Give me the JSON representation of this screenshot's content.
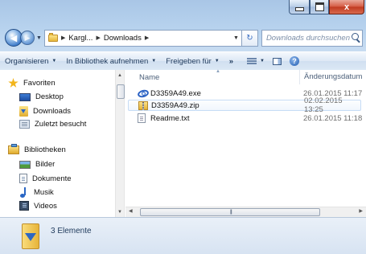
{
  "window": {
    "close_glyph": "x"
  },
  "nav": {
    "back_glyph": "◀",
    "forward_glyph": "▶",
    "breadcrumb": [
      "Kargl...",
      "Downloads"
    ],
    "refresh_glyph": "↻",
    "search_placeholder": "Downloads durchsuchen"
  },
  "toolbar": {
    "organize": "Organisieren",
    "include_library": "In Bibliothek aufnehmen",
    "share_with": "Freigeben für",
    "more": "»",
    "help_glyph": "?"
  },
  "sidebar": {
    "favorites": {
      "label": "Favoriten",
      "items": [
        {
          "label": "Desktop",
          "icon": "desktop-icon"
        },
        {
          "label": "Downloads",
          "icon": "downloads-icon"
        },
        {
          "label": "Zuletzt besucht",
          "icon": "recent-places-icon"
        }
      ]
    },
    "libraries": {
      "label": "Bibliotheken",
      "items": [
        {
          "label": "Bilder",
          "icon": "pictures-icon"
        },
        {
          "label": "Dokumente",
          "icon": "documents-icon"
        },
        {
          "label": "Musik",
          "icon": "music-icon"
        },
        {
          "label": "Videos",
          "icon": "videos-icon"
        }
      ]
    }
  },
  "file_list": {
    "columns": {
      "name": "Name",
      "date": "Änderungsdatum"
    },
    "files": [
      {
        "name": "D3359A49.exe",
        "date": "26.01.2015 11:17",
        "icon": "exe-icon",
        "selected": false
      },
      {
        "name": "D3359A49.zip",
        "date": "02.02.2015 13:25",
        "icon": "zip-folder-icon",
        "selected": true
      },
      {
        "name": "Readme.txt",
        "date": "26.01.2015 11:18",
        "icon": "text-file-icon",
        "selected": false
      }
    ]
  },
  "details": {
    "count": "3 Elemente"
  }
}
